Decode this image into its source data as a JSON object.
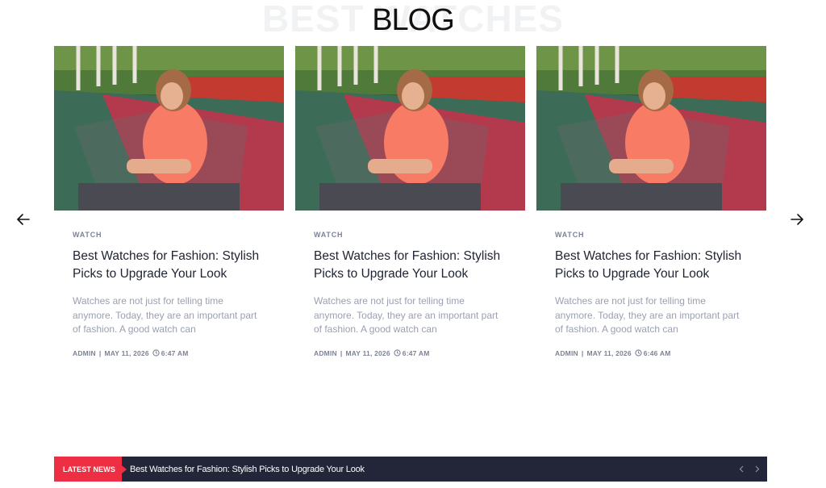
{
  "section": {
    "background_title": "BEST WATCHES",
    "title": "BLOG"
  },
  "carousel": {
    "prev_icon": "arrow-left-icon",
    "next_icon": "arrow-right-icon"
  },
  "posts": [
    {
      "category": "WATCH",
      "title": "Best Watches for Fashion: Stylish Picks to Upgrade Your Look",
      "excerpt": "Watches are not just for telling time anymore. Today, they are an important part of fashion. A good watch can",
      "author": "ADMIN",
      "date": "MAY 11, 2026",
      "time": "6:47 AM"
    },
    {
      "category": "WATCH",
      "title": "Best Watches for Fashion: Stylish Picks to Upgrade Your Look",
      "excerpt": "Watches are not just for telling time anymore. Today, they are an important part of fashion. A good watch can",
      "author": "ADMIN",
      "date": "MAY 11, 2026",
      "time": "6:47 AM"
    },
    {
      "category": "WATCH",
      "title": "Best Watches for Fashion: Stylish Picks to Upgrade Your Look",
      "excerpt": "Watches are not just for telling time anymore. Today, they are an important part of fashion. A good watch can",
      "author": "ADMIN",
      "date": "MAY 11, 2026",
      "time": "6:46 AM"
    }
  ],
  "news_ticker": {
    "label": "LATEST NEWS",
    "headline": "Best Watches for Fashion: Stylish Picks to Upgrade Your Look",
    "prev_icon": "chevron-left-icon",
    "next_icon": "chevron-right-icon"
  },
  "colors": {
    "accent": "#ee2e42",
    "ticker_bg": "#222638",
    "muted_text": "#9aa0b1",
    "heading_text": "#1f2333"
  }
}
